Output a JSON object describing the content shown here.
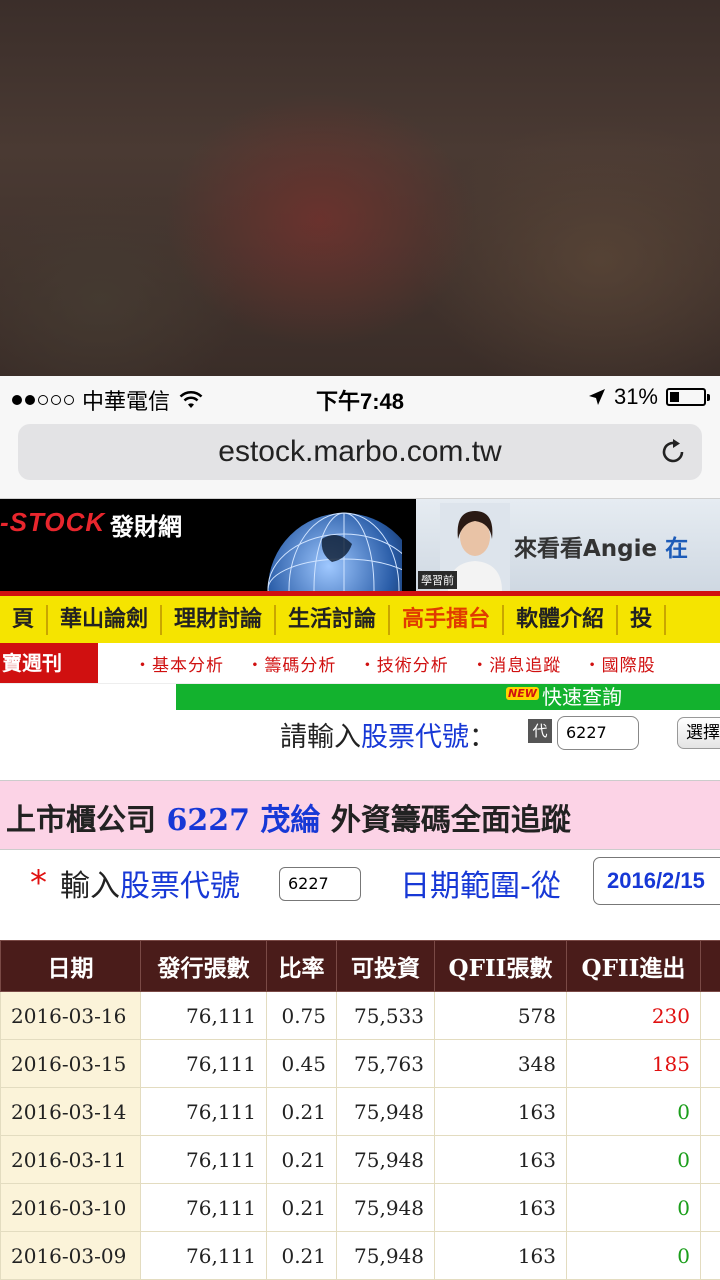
{
  "status": {
    "carrier": "中華電信",
    "time": "下午7:48",
    "battery": "31%",
    "battery_level": 0.31,
    "signal_bars": 2
  },
  "browser": {
    "url": "estock.marbo.com.tw"
  },
  "banner": {
    "logo": "-STOCK",
    "site_name": "發財網",
    "ad_caption": "學習前",
    "ad_text": "來看看Angie",
    "ad_text_blue": "在"
  },
  "nav": {
    "items": [
      "頁",
      "華山論劍",
      "理財討論",
      "生活討論",
      "高手擂台",
      "軟體介紹",
      "投"
    ]
  },
  "subnav": {
    "weekly": "寶週刊",
    "links": [
      "・基本分析",
      "・籌碼分析",
      "・技術分析",
      "・消息追蹤",
      "・國際股"
    ]
  },
  "quick": {
    "new_badge": "NEW",
    "label": "快速查詢"
  },
  "search": {
    "prompt_prefix": "請輸入",
    "prompt_link": "股票代號",
    "prompt_colon": "：",
    "badge": "代",
    "code_value": "6227",
    "select_button": "選擇"
  },
  "title": {
    "prefix": "上市櫃公司",
    "code": "6227",
    "name": "茂綸",
    "suffix": "外資籌碼全面追蹤"
  },
  "form": {
    "star": "*",
    "label_prefix": "輸入",
    "label_link": "股票代號",
    "code_value": "6227",
    "date_label": "日期範圍-從",
    "date_value": "2016/2/15"
  },
  "table": {
    "headers": [
      "日期",
      "發行張數",
      "比率",
      "可投資",
      "QFII張數",
      "QFII進出",
      "Λ"
    ],
    "rows": [
      {
        "date": "2016-03-16",
        "issued": "76,111",
        "ratio": "0.75",
        "investable": "75,533",
        "qfii": "578",
        "flow": "230",
        "flow_color": "red"
      },
      {
        "date": "2016-03-15",
        "issued": "76,111",
        "ratio": "0.45",
        "investable": "75,763",
        "qfii": "348",
        "flow": "185",
        "flow_color": "red"
      },
      {
        "date": "2016-03-14",
        "issued": "76,111",
        "ratio": "0.21",
        "investable": "75,948",
        "qfii": "163",
        "flow": "0",
        "flow_color": "green"
      },
      {
        "date": "2016-03-11",
        "issued": "76,111",
        "ratio": "0.21",
        "investable": "75,948",
        "qfii": "163",
        "flow": "0",
        "flow_color": "green"
      },
      {
        "date": "2016-03-10",
        "issued": "76,111",
        "ratio": "0.21",
        "investable": "75,948",
        "qfii": "163",
        "flow": "0",
        "flow_color": "green"
      },
      {
        "date": "2016-03-09",
        "issued": "76,111",
        "ratio": "0.21",
        "investable": "75,948",
        "qfii": "163",
        "flow": "0",
        "flow_color": "green"
      }
    ]
  },
  "colors": {
    "accent_red": "#d01010",
    "link_blue": "#1738d6",
    "nav_yellow": "#f5e400",
    "quick_green": "#13b22e",
    "title_pink": "#fcd3e6",
    "header_brown": "#4a1c1a"
  }
}
